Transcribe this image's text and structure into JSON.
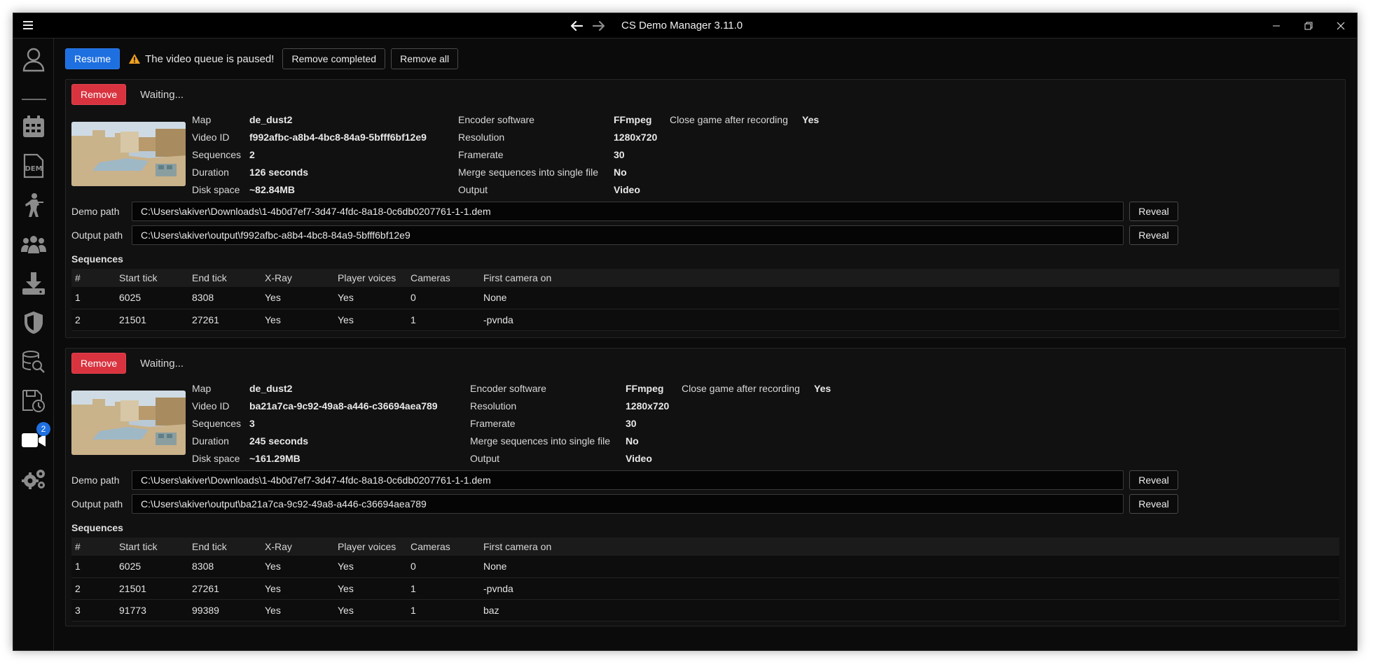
{
  "app": {
    "title": "CS Demo Manager 3.11.0"
  },
  "sidebar": {
    "items": [
      {
        "icon": "user-icon"
      },
      {
        "icon": "calendar-icon"
      },
      {
        "icon": "dem-file-icon"
      },
      {
        "icon": "soldier-icon"
      },
      {
        "icon": "team-icon"
      },
      {
        "icon": "download-icon"
      },
      {
        "icon": "shield-icon"
      },
      {
        "icon": "database-search-icon"
      },
      {
        "icon": "save-clock-icon"
      },
      {
        "icon": "video-camera-icon",
        "badge": "2"
      },
      {
        "icon": "gears-icon"
      }
    ]
  },
  "toolbar": {
    "resume_label": "Resume",
    "warning_text": "The video queue is paused!",
    "remove_completed_label": "Remove completed",
    "remove_all_label": "Remove all"
  },
  "labels": {
    "remove": "Remove",
    "map": "Map",
    "video_id": "Video ID",
    "sequences": "Sequences",
    "duration": "Duration",
    "disk_space": "Disk space",
    "encoder_software": "Encoder software",
    "resolution": "Resolution",
    "framerate": "Framerate",
    "merge_sequences": "Merge sequences into single file",
    "output": "Output",
    "close_game": "Close game after recording",
    "demo_path": "Demo path",
    "output_path": "Output path",
    "reveal": "Reveal",
    "sequences_title": "Sequences",
    "columns": [
      "#",
      "Start tick",
      "End tick",
      "X-Ray",
      "Player voices",
      "Cameras",
      "First camera on"
    ]
  },
  "videos": [
    {
      "status": "Waiting...",
      "map": "de_dust2",
      "video_id": "f992afbc-a8b4-4bc8-84a9-5bfff6bf12e9",
      "sequences": "2",
      "duration": "126 seconds",
      "disk_space": "~82.84MB",
      "encoder_software": "FFmpeg",
      "resolution": "1280x720",
      "framerate": "30",
      "merge_sequences": "No",
      "output": "Video",
      "close_game": "Yes",
      "demo_path": "C:\\Users\\akiver\\Downloads\\1-4b0d7ef7-3d47-4fdc-8a18-0c6db0207761-1-1.dem",
      "output_path": "C:\\Users\\akiver\\output\\f992afbc-a8b4-4bc8-84a9-5bfff6bf12e9",
      "rows": [
        [
          "1",
          "6025",
          "8308",
          "Yes",
          "Yes",
          "0",
          "None"
        ],
        [
          "2",
          "21501",
          "27261",
          "Yes",
          "Yes",
          "1",
          "-pvnda"
        ]
      ]
    },
    {
      "status": "Waiting...",
      "map": "de_dust2",
      "video_id": "ba21a7ca-9c92-49a8-a446-c36694aea789",
      "sequences": "3",
      "duration": "245 seconds",
      "disk_space": "~161.29MB",
      "encoder_software": "FFmpeg",
      "resolution": "1280x720",
      "framerate": "30",
      "merge_sequences": "No",
      "output": "Video",
      "close_game": "Yes",
      "demo_path": "C:\\Users\\akiver\\Downloads\\1-4b0d7ef7-3d47-4fdc-8a18-0c6db0207761-1-1.dem",
      "output_path": "C:\\Users\\akiver\\output\\ba21a7ca-9c92-49a8-a446-c36694aea789",
      "rows": [
        [
          "1",
          "6025",
          "8308",
          "Yes",
          "Yes",
          "0",
          "None"
        ],
        [
          "2",
          "21501",
          "27261",
          "Yes",
          "Yes",
          "1",
          "-pvnda"
        ],
        [
          "3",
          "91773",
          "99389",
          "Yes",
          "Yes",
          "1",
          "baz"
        ]
      ]
    }
  ]
}
